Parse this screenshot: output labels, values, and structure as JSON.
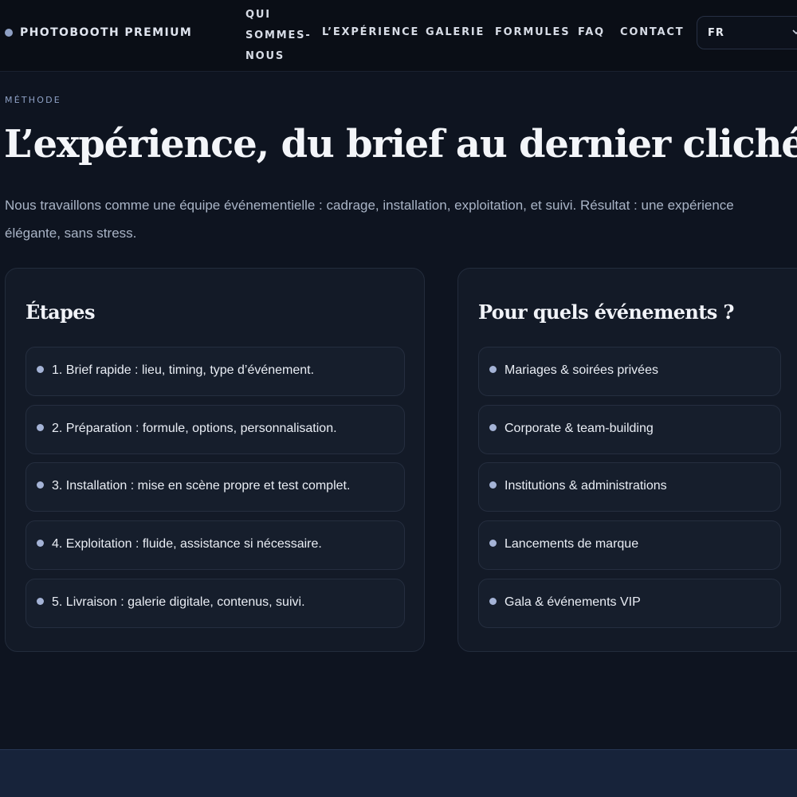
{
  "header": {
    "brand": "PHOTOBOOTH PREMIUM",
    "nav": [
      "QUI SOMMES-NOUS",
      "L’EXPÉRIENCE",
      "GALERIE",
      "FORMULES",
      "FAQ",
      "CONTACT"
    ],
    "language": {
      "selected": "FR",
      "icon": "chevron-down-icon"
    }
  },
  "section": {
    "eyebrow": "MÉTHODE",
    "title": "L’expérience, du brief au dernier cliché",
    "intro": "Nous travaillons comme une équipe événementielle : cadrage, installation, exploitation, et suivi. Résultat : une expérience élégante, sans stress."
  },
  "steps": {
    "title": "Étapes",
    "items": [
      "1. Brief rapide : lieu, timing, type d’événement.",
      "2. Préparation : formule, options, personnalisation.",
      "3. Installation : mise en scène propre et test complet.",
      "4. Exploitation : fluide, assistance si nécessaire.",
      "5. Livraison : galerie digitale, contenus, suivi."
    ]
  },
  "events": {
    "title": "Pour quels événements ?",
    "items": [
      "Mariages & soirées privées",
      "Corporate & team-building",
      "Institutions & administrations",
      "Lancements de marque",
      "Gala & événements VIP"
    ]
  },
  "colors": {
    "background": "#0e1420",
    "header": "#0a0e16",
    "accent": "#a4b3d6",
    "card": "#131a27"
  }
}
